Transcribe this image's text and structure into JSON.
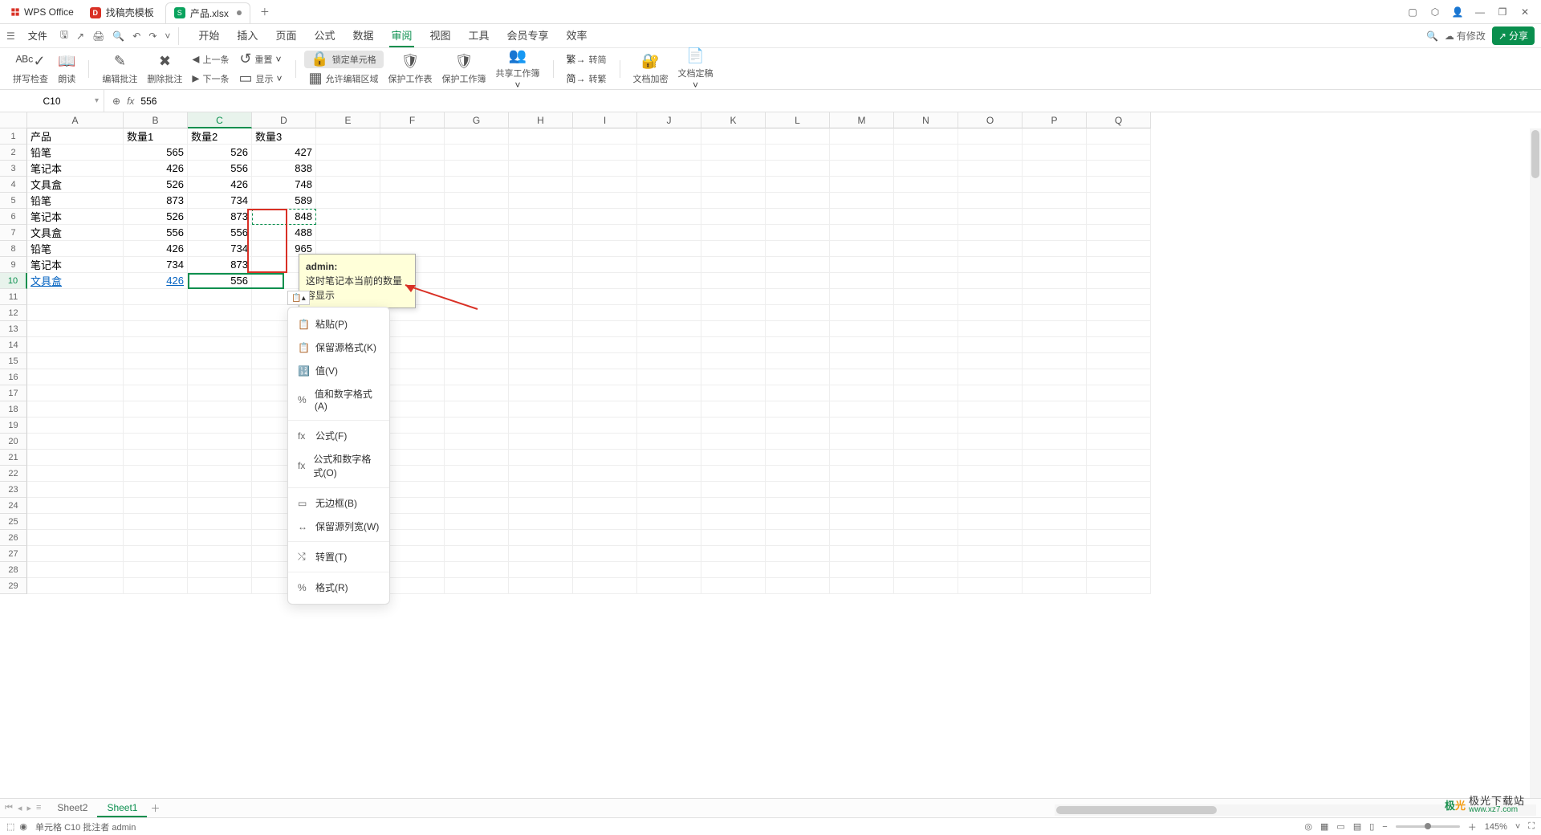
{
  "titlebar": {
    "app": "WPS Office",
    "template_tab": "找稿壳模板",
    "file_tab": "产品.xlsx"
  },
  "menubar": {
    "file": "文件",
    "tabs": [
      "开始",
      "插入",
      "页面",
      "公式",
      "数据",
      "审阅",
      "视图",
      "工具",
      "会员专享",
      "效率"
    ],
    "active": 5,
    "modify": "有修改",
    "share": "分享"
  },
  "ribbon": {
    "spellcheck": "拼写检查",
    "read": "朗读",
    "editcomment": "编辑批注",
    "delcomment": "删除批注",
    "prev": "上一条",
    "next": "下一条",
    "reset": "重置",
    "show": "显示",
    "lockcell": "锁定单元格",
    "allowrange": "允许编辑区域",
    "protectsheet": "保护工作表",
    "protectbook": "保护工作簿",
    "sharewb": "共享工作簿",
    "simp": "转简",
    "trad": "转繁",
    "encrypt": "文档加密",
    "finalize": "文档定稿"
  },
  "namebox": {
    "cell": "C10",
    "formula": "556"
  },
  "columns": [
    "A",
    "B",
    "C",
    "D",
    "E",
    "F",
    "G",
    "H",
    "I",
    "J",
    "K",
    "L",
    "M",
    "N",
    "O",
    "P",
    "Q"
  ],
  "rows": 29,
  "table": {
    "headers": [
      "产品",
      "数量1",
      "数量2",
      "数量3"
    ],
    "data": [
      [
        "铅笔",
        "565",
        "526",
        "427"
      ],
      [
        "笔记本",
        "426",
        "556",
        "838"
      ],
      [
        "文具盒",
        "526",
        "426",
        "748"
      ],
      [
        "铅笔",
        "873",
        "734",
        "589"
      ],
      [
        "笔记本",
        "526",
        "873",
        "848"
      ],
      [
        "文具盒",
        "556",
        "556",
        "488"
      ],
      [
        "铅笔",
        "426",
        "734",
        "965"
      ],
      [
        "笔记本",
        "734",
        "873",
        ""
      ],
      [
        "文具盒",
        "426",
        "556",
        ""
      ]
    ]
  },
  "comment": {
    "author": "admin:",
    "line1": "这时笔记本当前的数量",
    "line2": "容显示"
  },
  "pastemenu": {
    "items": [
      {
        "icon": "📋",
        "label": "粘贴(P)"
      },
      {
        "icon": "📋",
        "label": "保留源格式(K)"
      },
      {
        "icon": "🔢",
        "label": "值(V)"
      },
      {
        "icon": "%",
        "label": "值和数字格式(A)"
      },
      {
        "sep": true
      },
      {
        "icon": "fx",
        "label": "公式(F)"
      },
      {
        "icon": "fx",
        "label": "公式和数字格式(O)"
      },
      {
        "sep": true
      },
      {
        "icon": "▭",
        "label": "无边框(B)"
      },
      {
        "icon": "↔",
        "label": "保留源列宽(W)"
      },
      {
        "sep": true
      },
      {
        "icon": "⤭",
        "label": "转置(T)"
      },
      {
        "sep": true
      },
      {
        "icon": "%",
        "label": "格式(R)"
      }
    ]
  },
  "sheetbar": {
    "sheets": [
      "Sheet2",
      "Sheet1"
    ],
    "active": 1
  },
  "statusbar": {
    "text": "单元格 C10 批注者 admin",
    "zoom": "145%"
  },
  "watermark": {
    "name": "极光下载站",
    "url": "www.xz7.com"
  }
}
